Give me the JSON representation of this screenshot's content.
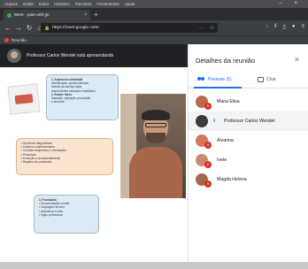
{
  "menubar": {
    "items": [
      "Arquivo",
      "Editar",
      "Exibir",
      "Histórico",
      "Favoritos",
      "Ferramentas",
      "Ajuda"
    ]
  },
  "browser": {
    "tab_title": "Meet - pwe-vrkf-jjn",
    "url": "https://meet.google.com/",
    "bookmark": "Reunião"
  },
  "stage": {
    "presenter_label": "Professor Carlos Wendel está apresentando"
  },
  "slide": {
    "box1_lines": [
      "1. Anamnese detalhada",
      "Identificação, queixa principal,",
      "história da doença atual,",
      "antecedentes pessoais e familiares",
      "2. Exame físico",
      "Inspeção, palpação, percussão",
      "e ausculta"
    ],
    "box2_lines": [
      "• Hipóteses diagnósticas",
      "• Exames complementares",
      "• Conduta terapêutica e orientações",
      "• Prescrição",
      "• Evolução e acompanhamento",
      "• Registro em prontuário"
    ],
    "box3_lines": [
      "3. Prontuário",
      "• Documentação correta",
      "• Linguagem técnica",
      "• Assinatura e data",
      "• Sigilo profissional"
    ]
  },
  "panel": {
    "title": "Detalhes da reunião",
    "tab_people": "Pessoas (5)",
    "tab_chat": "Chat",
    "participants": [
      {
        "name": "Maria Elisa"
      },
      {
        "name": "Professor Carlos Wendel"
      },
      {
        "name": "Alvarina"
      },
      {
        "name": "Ivete"
      },
      {
        "name": "Magda Helena"
      }
    ]
  }
}
